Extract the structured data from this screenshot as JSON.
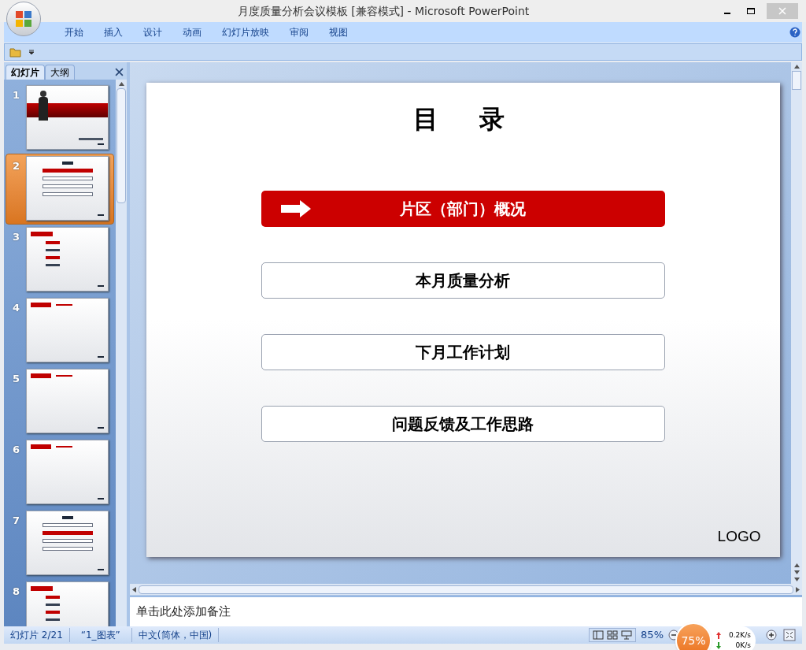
{
  "window": {
    "title": "月度质量分析会议模板 [兼容模式] - Microsoft PowerPoint"
  },
  "ribbon_tabs": [
    "开始",
    "插入",
    "设计",
    "动画",
    "幻灯片放映",
    "审阅",
    "视图"
  ],
  "pane_tabs": [
    {
      "label": "幻灯片",
      "selected": true
    },
    {
      "label": "大纲",
      "selected": false
    }
  ],
  "thumbnails": [
    {
      "number": "1",
      "kind": "title",
      "selected": false
    },
    {
      "number": "2",
      "kind": "toc",
      "selected": true
    },
    {
      "number": "3",
      "kind": "bullets",
      "selected": false
    },
    {
      "number": "4",
      "kind": "header",
      "selected": false
    },
    {
      "number": "5",
      "kind": "header",
      "selected": false
    },
    {
      "number": "6",
      "kind": "header",
      "selected": false
    },
    {
      "number": "7",
      "kind": "toc",
      "selected": false
    },
    {
      "number": "8",
      "kind": "bullets",
      "selected": false
    }
  ],
  "slide": {
    "title": "目　录",
    "items": [
      {
        "label": "片区（部门）概况",
        "selected": true
      },
      {
        "label": "本月质量分析",
        "selected": false
      },
      {
        "label": "下月工作计划",
        "selected": false
      },
      {
        "label": "问题反馈及工作思路",
        "selected": false
      }
    ],
    "logo": "LOGO"
  },
  "notes": {
    "placeholder": "单击此处添加备注"
  },
  "status_bar": {
    "slide": "幻灯片 2/21",
    "theme": "“1_图表”",
    "language": "中文(简体，中国)",
    "zoom": "85%"
  },
  "overlay": {
    "percent": "75%",
    "upload": "0.2K/s",
    "download": "0K/s"
  }
}
